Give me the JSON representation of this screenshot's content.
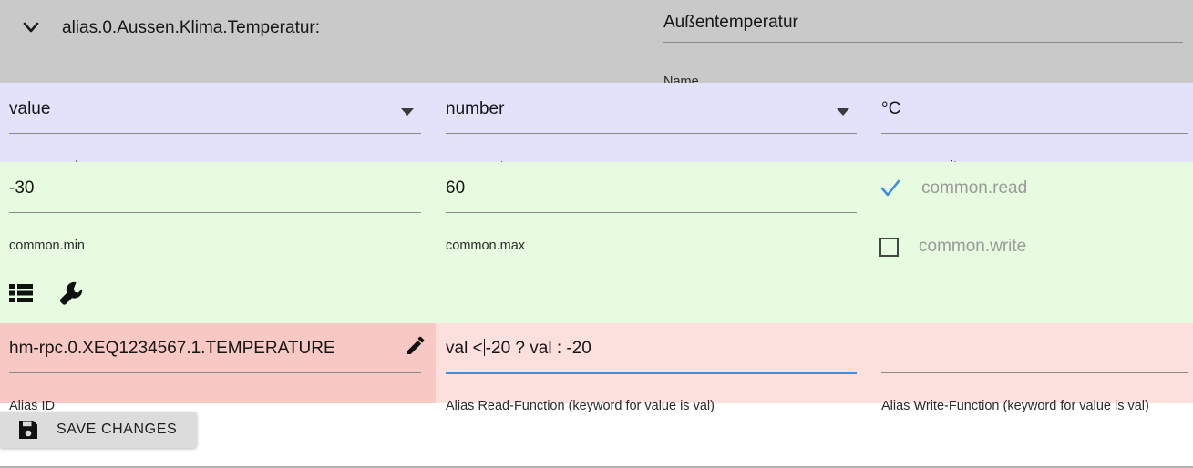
{
  "header": {
    "expand_icon": "chevron-down-icon",
    "object_id": "alias.0.Aussen.Klima.Temperatur:",
    "name": {
      "value": "Außentemperatur",
      "label": "Name"
    }
  },
  "common_section": {
    "role": {
      "value": "value",
      "label": "common.role",
      "dropdown_icon": "chevron-down-icon"
    },
    "type": {
      "value": "number",
      "label": "common.type",
      "dropdown_icon": "chevron-down-icon"
    },
    "unit": {
      "value": "°C",
      "label": "common.unit"
    }
  },
  "range_section": {
    "min": {
      "value": "-30",
      "label": "common.min"
    },
    "max": {
      "value": "60",
      "label": "common.max"
    },
    "read": {
      "label": "common.read",
      "checked": true,
      "icon": "check-icon"
    },
    "write": {
      "label": "common.write",
      "checked": false,
      "icon": "checkbox-empty-icon"
    },
    "tools": [
      {
        "icon": "list-icon",
        "name": "list-view-button"
      },
      {
        "icon": "wrench-icon",
        "name": "settings-wrench-button"
      }
    ]
  },
  "alias_section": {
    "alias_id": {
      "value": "hm-rpc.0.XEQ1234567.1.TEMPERATURE",
      "label": "Alias ID",
      "edit_icon": "pencil-icon"
    },
    "read_function": {
      "value_before_caret": "val <",
      "value_after_caret": "-20 ? val : -20",
      "label": "Alias Read-Function (keyword for value is val)",
      "focused": true
    },
    "write_function": {
      "value": "",
      "label": "Alias Write-Function (keyword for value is val)",
      "focused": false
    }
  },
  "footer": {
    "save_button": {
      "label": "SAVE CHANGES",
      "icon": "save-floppy-icon"
    }
  },
  "colors": {
    "header_band": "#c9c9c9",
    "common_band": "#e3e2fb",
    "range_band": "#e6fbe0",
    "alias_band": "#fce0de",
    "alias_band_dark": "#f8c8c5",
    "focus_underline": "#3f8ee0",
    "checkbox_check": "#3f8ee0",
    "disabled_label": "#9a9a9a",
    "save_button_bg": "#dcdcdc"
  }
}
